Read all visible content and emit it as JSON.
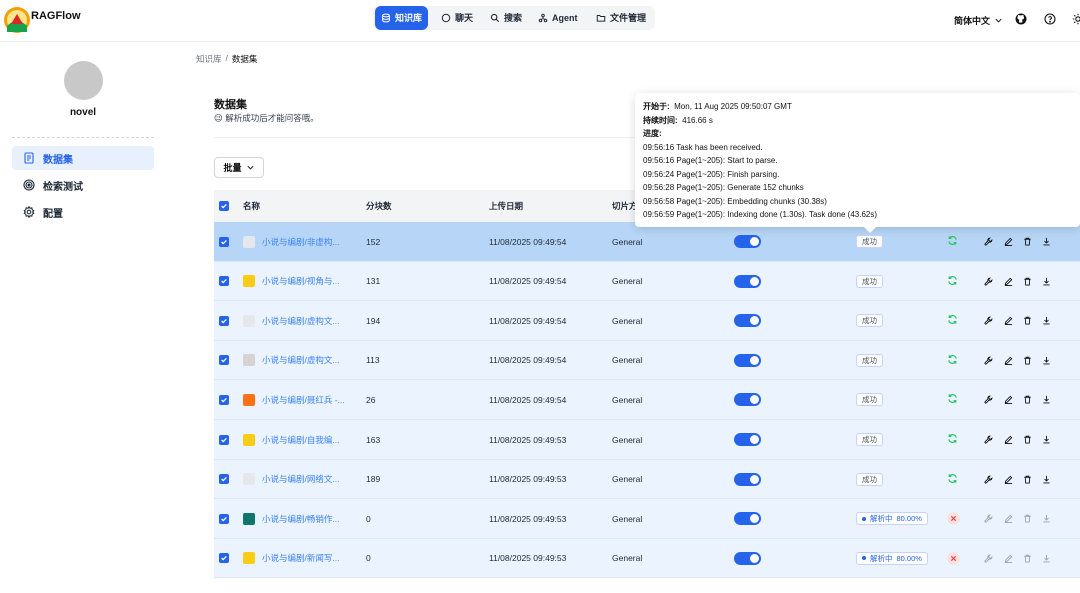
{
  "app": {
    "brand": "RAGFlow"
  },
  "nav": {
    "items": [
      {
        "label": "知识库",
        "icon": "database-icon",
        "active": true
      },
      {
        "label": "聊天",
        "icon": "chat-icon"
      },
      {
        "label": "搜索",
        "icon": "search-icon"
      },
      {
        "label": "Agent",
        "icon": "agent-icon"
      },
      {
        "label": "文件管理",
        "icon": "folder-icon"
      }
    ]
  },
  "header": {
    "language": "简体中文"
  },
  "sidebar": {
    "kb_name": "novel",
    "items": [
      {
        "label": "数据集",
        "icon": "file-text-icon",
        "active": true
      },
      {
        "label": "检索测试",
        "icon": "target-icon"
      },
      {
        "label": "配置",
        "icon": "gear-icon"
      }
    ]
  },
  "breadcrumb": {
    "root": "知识库",
    "sep": "/",
    "current": "数据集"
  },
  "page": {
    "title": "数据集",
    "subtitle": "😉 解析成功后才能问答哦。",
    "batch_label": "批量"
  },
  "table": {
    "headers": {
      "name": "名称",
      "chunks": "分块数",
      "date": "上传日期",
      "method": "切片方"
    },
    "rows": [
      {
        "name": "小说与编剧/非虚构...",
        "chunks": "152",
        "date": "11/08/2025 09:49:54",
        "method": "General",
        "status": "成功",
        "parsing": false,
        "icon_color": "#e5e7eb"
      },
      {
        "name": "小说与编剧/视角与...",
        "chunks": "131",
        "date": "11/08/2025 09:49:54",
        "method": "General",
        "status": "成功",
        "parsing": false,
        "icon_color": "#facc15"
      },
      {
        "name": "小说与编剧/虚构文...",
        "chunks": "194",
        "date": "11/08/2025 09:49:54",
        "method": "General",
        "status": "成功",
        "parsing": false,
        "icon_color": "#e5e7eb"
      },
      {
        "name": "小说与编剧/虚构文...",
        "chunks": "113",
        "date": "11/08/2025 09:49:54",
        "method": "General",
        "status": "成功",
        "parsing": false,
        "icon_color": "#d6d3d1"
      },
      {
        "name": "小说与编剧/聂红兵 -...",
        "chunks": "26",
        "date": "11/08/2025 09:49:54",
        "method": "General",
        "status": "成功",
        "parsing": false,
        "icon_color": "#f97316"
      },
      {
        "name": "小说与编剧/自我编...",
        "chunks": "163",
        "date": "11/08/2025 09:49:53",
        "method": "General",
        "status": "成功",
        "parsing": false,
        "icon_color": "#facc15"
      },
      {
        "name": "小说与编剧/网络文...",
        "chunks": "189",
        "date": "11/08/2025 09:49:53",
        "method": "General",
        "status": "成功",
        "parsing": false,
        "icon_color": "#e5e7eb"
      },
      {
        "name": "小说与编剧/畅销作...",
        "chunks": "0",
        "date": "11/08/2025 09:49:53",
        "method": "General",
        "status": "解析中",
        "progress": "80.00%",
        "parsing": true,
        "icon_color": "#0f766e"
      },
      {
        "name": "小说与编剧/新闻写...",
        "chunks": "0",
        "date": "11/08/2025 09:49:53",
        "method": "General",
        "status": "解析中",
        "progress": "80.00%",
        "parsing": true,
        "icon_color": "#facc15"
      }
    ]
  },
  "tooltip": {
    "start_label": "开始于:",
    "start_value": "Mon, 11 Aug 2025 09:50:07 GMT",
    "duration_label": "持续时间:",
    "duration_value": "416.66 s",
    "progress_label": "进度:",
    "logs": [
      "09:56:16 Task has been received.",
      "09:56:16 Page(1~205): Start to parse.",
      "09:56:24 Page(1~205): Finish parsing.",
      "09:56:28 Page(1~205): Generate 152 chunks",
      "09:56:58 Page(1~205): Embedding chunks (30.38s)",
      "09:56:59 Page(1~205): Indexing done (1.30s). Task done (43.62s)"
    ]
  },
  "colors": {
    "accent": "#2563eb",
    "row_bg": "#eaf3fe",
    "row_selected": "#b7d6f7",
    "success_refresh": "#22c55e",
    "cancel_red": "#ef4444"
  }
}
